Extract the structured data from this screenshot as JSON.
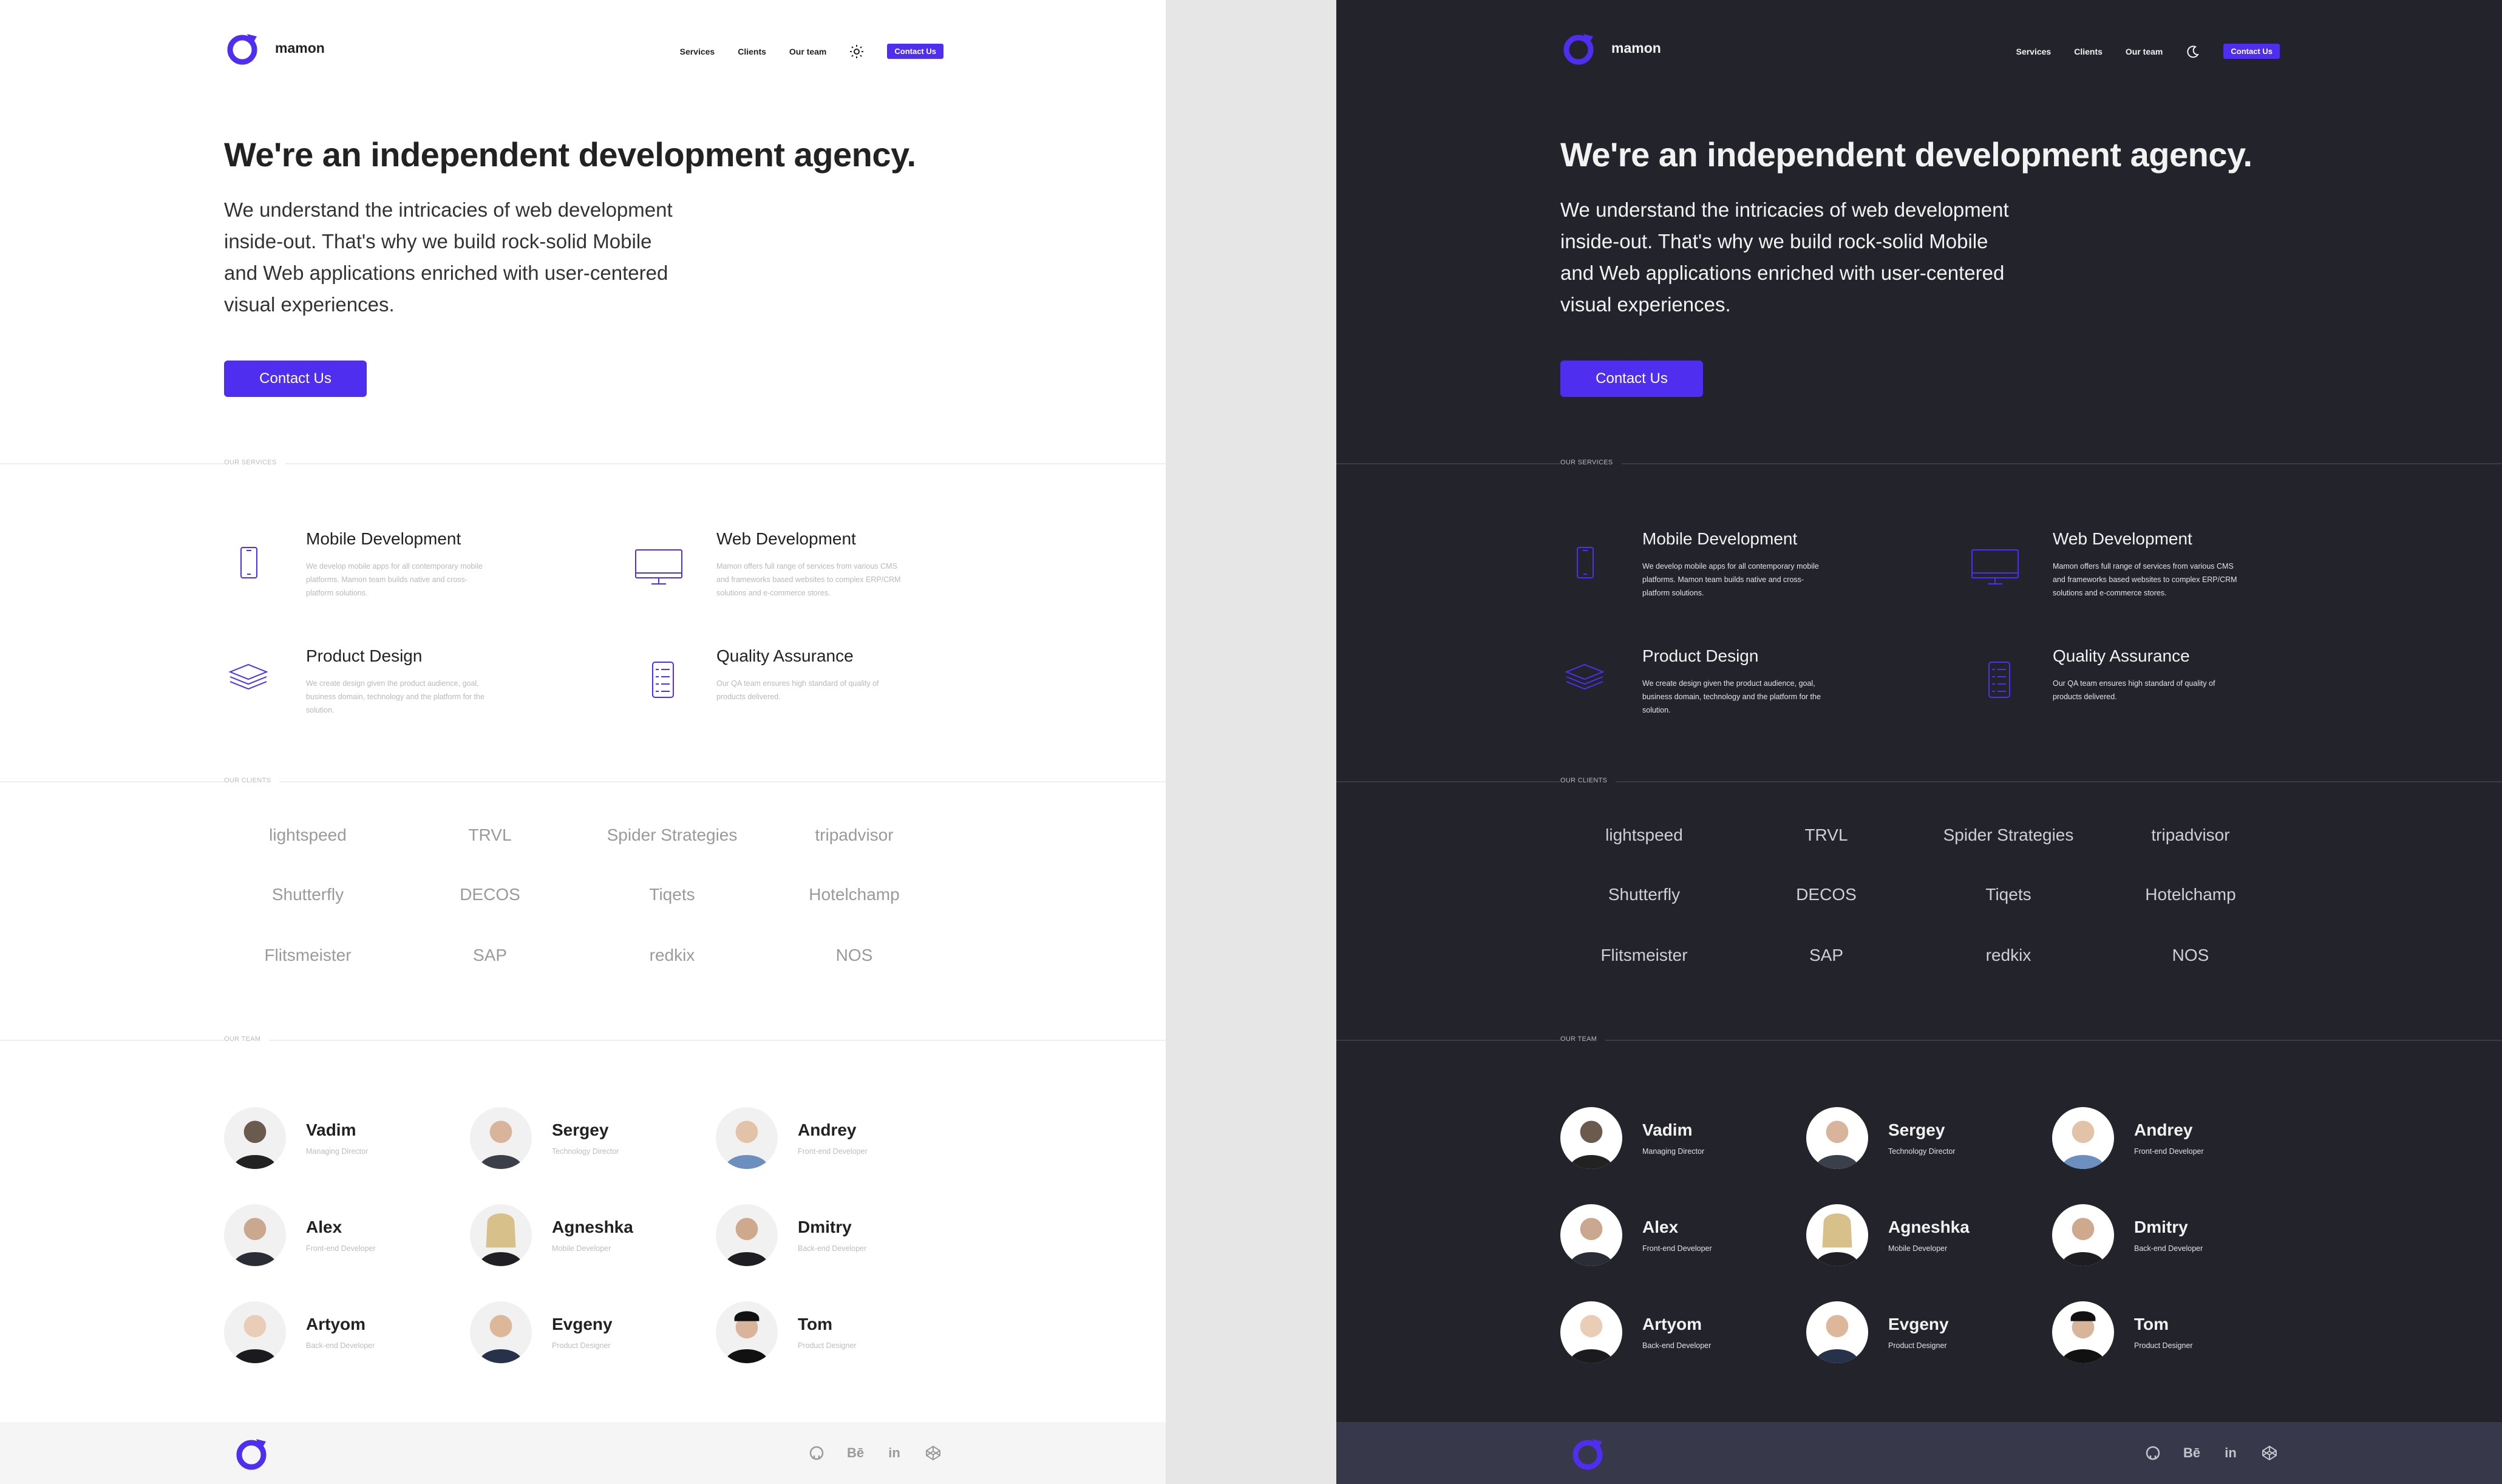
{
  "brand": {
    "name": "mamon",
    "accent": "#4f2ef0"
  },
  "nav": {
    "items": [
      "Services",
      "Clients",
      "Our team"
    ],
    "cta": "Contact Us",
    "light_theme_icon": "sun-icon",
    "dark_theme_icon": "moon-icon"
  },
  "hero": {
    "title": "We're an independent development agency.",
    "text": "We understand the intricacies of web development inside-out. That's why we build rock-solid Mobile and Web applications enriched with user-centered visual experiences.",
    "button": "Contact Us"
  },
  "sections": {
    "services": "OUR SERVICES",
    "clients": "OUR CLIENTS",
    "team": "OUR TEAM"
  },
  "services": [
    {
      "icon": "mobile-icon",
      "title": "Mobile Development",
      "desc": "We develop mobile apps for all contemporary mobile platforms. Mamon team builds native and cross-platform solutions."
    },
    {
      "icon": "monitor-icon",
      "title": "Web Development",
      "desc": "Mamon offers full range of services from various CMS and frameworks based websites to complex ERP/CRM solutions and e-commerce stores."
    },
    {
      "icon": "layers-icon",
      "title": "Product Design",
      "desc": "We create design given the product audience, goal, business domain, technology and the platform for the solution."
    },
    {
      "icon": "checklist-icon",
      "title": "Quality Assurance",
      "desc": "Our QA team ensures high standard of quality of products delivered."
    }
  ],
  "clients": [
    "lightspeed",
    "TRVL",
    "Spider Strategies",
    "tripadvisor",
    "Shutterfly",
    "DECOS",
    "Tiqets",
    "Hotelchamp",
    "Flitsmeister",
    "SAP",
    "redkix",
    "NOS"
  ],
  "team": [
    {
      "name": "Vadim",
      "role": "Managing Director"
    },
    {
      "name": "Sergey",
      "role": "Technology Director"
    },
    {
      "name": "Andrey",
      "role": "Front-end Developer"
    },
    {
      "name": "Alex",
      "role": "Front-end Developer"
    },
    {
      "name": "Agneshka",
      "role": "Mobile Developer"
    },
    {
      "name": "Dmitry",
      "role": "Back-end Developer"
    },
    {
      "name": "Artyom",
      "role": "Back-end Developer"
    },
    {
      "name": "Evgeny",
      "role": "Product Designer"
    },
    {
      "name": "Tom",
      "role": "Product Designer"
    }
  ],
  "footer": {
    "social": [
      {
        "icon": "github-icon",
        "label": ""
      },
      {
        "icon": "behance-icon",
        "label": "Bē"
      },
      {
        "icon": "linkedin-icon",
        "label": "in"
      },
      {
        "icon": "codepen-icon",
        "label": ""
      }
    ]
  }
}
